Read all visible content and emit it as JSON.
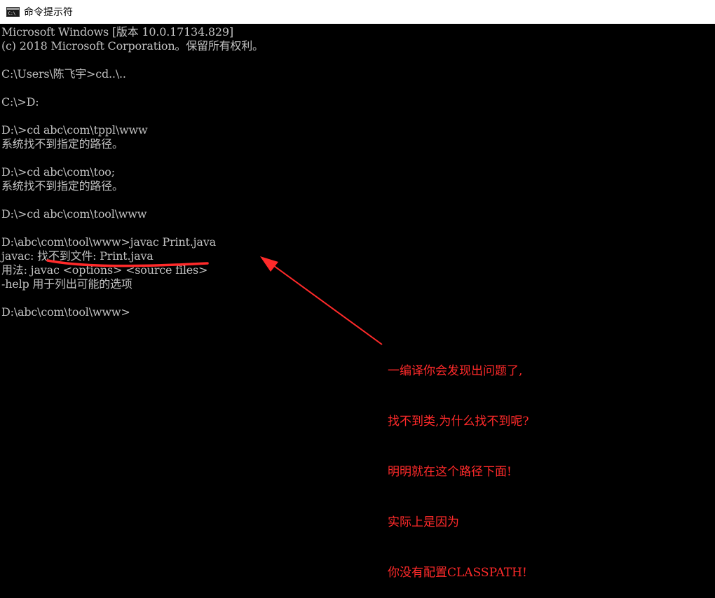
{
  "window": {
    "title": "命令提示符",
    "icon": "cmd-icon"
  },
  "console": {
    "lines": [
      "Microsoft Windows [版本 10.0.17134.829]",
      "(c) 2018 Microsoft Corporation。保留所有权利。",
      "",
      "C:\\Users\\陈飞宇>cd..\\..",
      "",
      "C:\\>D:",
      "",
      "D:\\>cd abc\\com\\tppl\\www",
      "系统找不到指定的路径。",
      "",
      "D:\\>cd abc\\com\\too;",
      "系统找不到指定的路径。",
      "",
      "D:\\>cd abc\\com\\tool\\www",
      "",
      "D:\\abc\\com\\tool\\www>javac Print.java",
      "javac: 找不到文件: Print.java",
      "用法: javac <options> <source files>",
      "-help 用于列出可能的选项",
      "",
      "D:\\abc\\com\\tool\\www>"
    ]
  },
  "annotation": {
    "color": "#ff2a2a",
    "lines": [
      "一编译你会发现出问题了,",
      "找不到类,为什么找不到呢?",
      "明明就在这个路径下面!",
      "实际上是因为",
      "你没有配置CLASSPATH!"
    ]
  }
}
